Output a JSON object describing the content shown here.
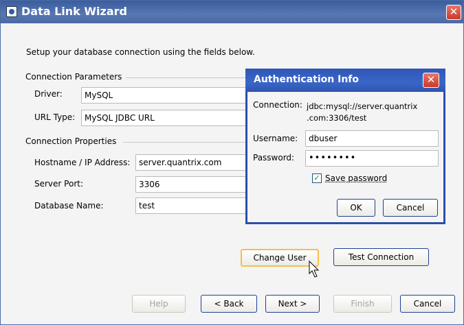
{
  "window": {
    "title": "Data Link Wizard",
    "close_glyph": "✕"
  },
  "intro": "Setup your database connection using the fields below.",
  "connection_parameters": {
    "title": "Connection Parameters",
    "driver_label": "Driver:",
    "driver_value": "MySQL",
    "url_type_label": "URL Type:",
    "url_type_value": "MySQL JDBC URL"
  },
  "connection_properties": {
    "title": "Connection Properties",
    "hostname_label": "Hostname / IP Address:",
    "hostname_value": "server.quantrix.com",
    "port_label": "Server Port:",
    "port_value": "3306",
    "dbname_label": "Database Name:",
    "dbname_value": "test"
  },
  "actions": {
    "change_user": "Change User",
    "test_connection": "Test Connection"
  },
  "nav": {
    "help": "Help",
    "back": "< Back",
    "next": "Next >",
    "finish": "Finish",
    "cancel": "Cancel"
  },
  "auth_dialog": {
    "title": "Authentication Info",
    "close_glyph": "✕",
    "connection_label": "Connection:",
    "connection_line1": "jdbc:mysql://server.quantrix",
    "connection_line2": ".com:3306/test",
    "username_label": "Username:",
    "username_value": "dbuser",
    "password_label": "Password:",
    "password_value": "••••••••",
    "save_password_label": "Save password",
    "save_password_checked": true,
    "ok": "OK",
    "cancel": "Cancel"
  },
  "colors": {
    "title_bar": "#4a6aa3",
    "dialog_title_bar": "#3a66c8",
    "close_red": "#d9533f",
    "button_border": "#1c3f94"
  }
}
